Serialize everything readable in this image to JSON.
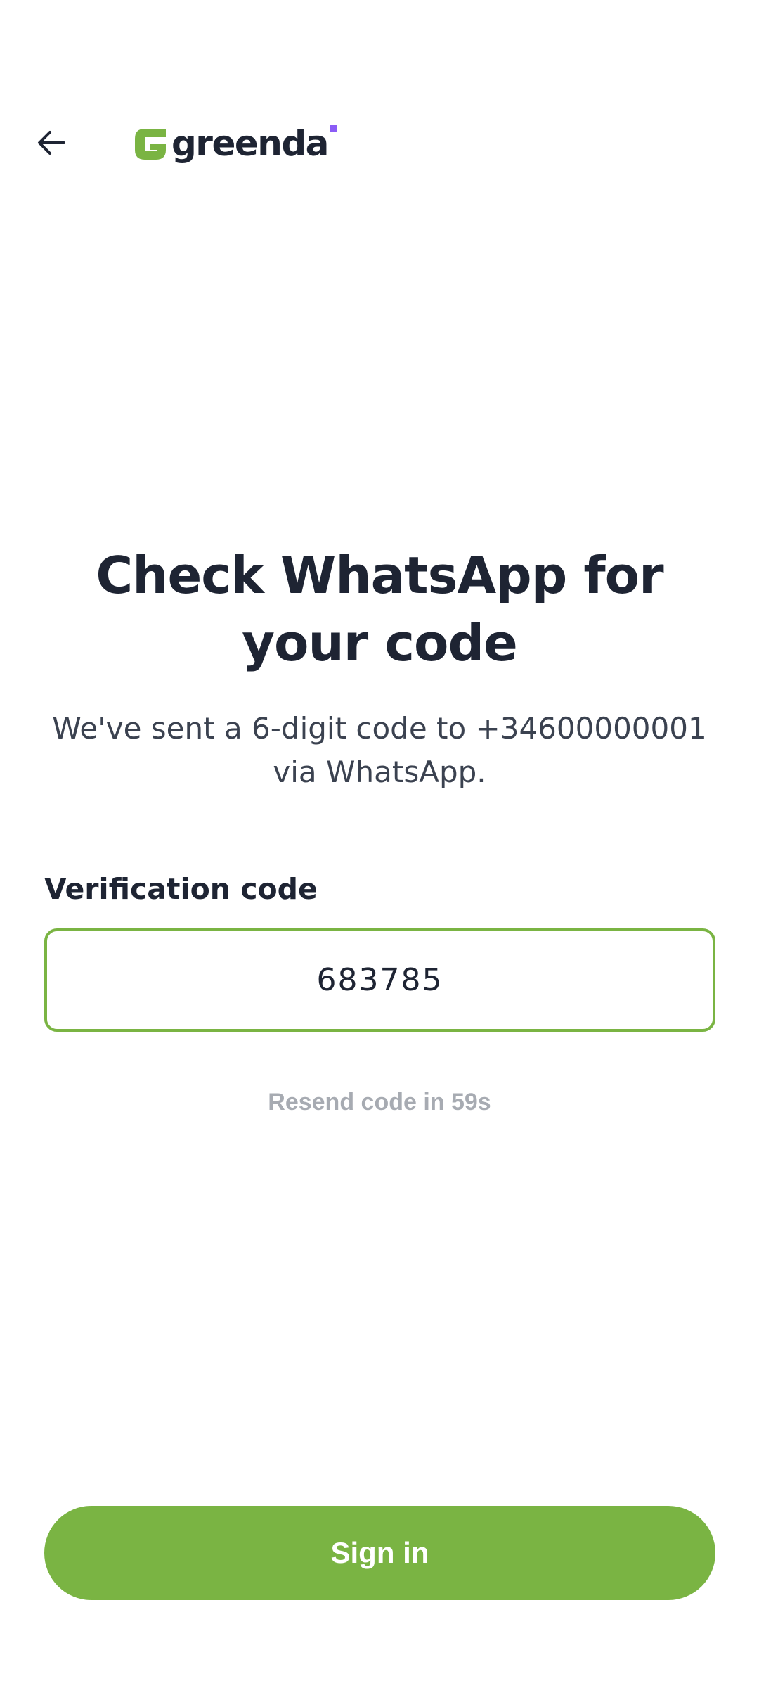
{
  "header": {
    "back_icon": "arrow-left-icon",
    "logo_text": "greenda",
    "colors": {
      "brand_green": "#7ab443",
      "logo_dot": "#8b5cf6",
      "text_dark": "#1e2433"
    }
  },
  "main": {
    "title": "Check WhatsApp for your code",
    "subtitle": "We've sent a 6-digit code to +34600000001 via WhatsApp.",
    "field_label": "Verification code",
    "code_value": "683785",
    "resend_text": "Resend code in 59s"
  },
  "footer": {
    "signin_label": "Sign in"
  }
}
